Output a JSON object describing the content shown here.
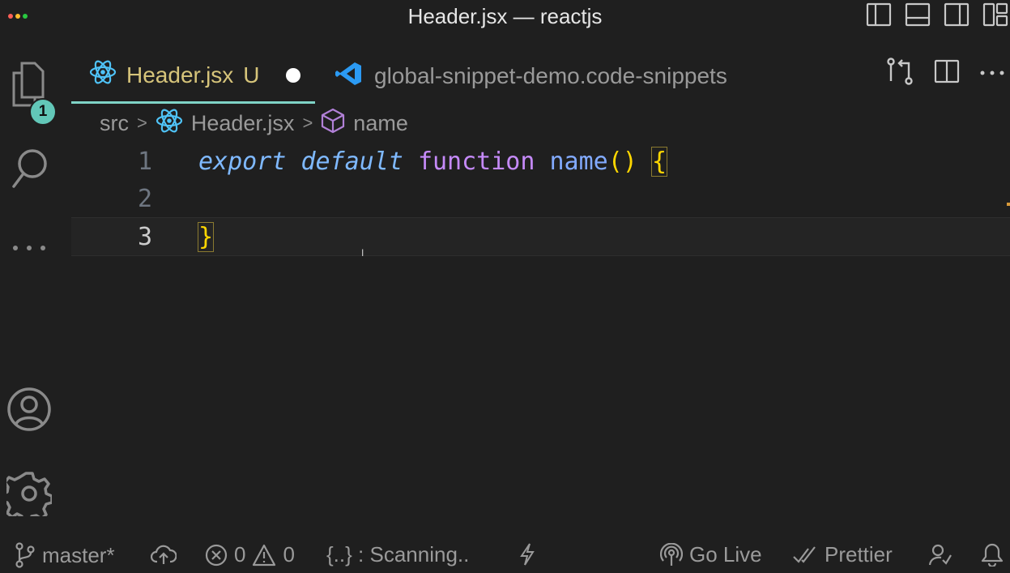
{
  "window": {
    "title": "Header.jsx — reactjs"
  },
  "activity_bar": {
    "explorer_badge": "1"
  },
  "tabs": [
    {
      "label": "Header.jsx",
      "status": "U",
      "modified": true,
      "icon": "react-icon",
      "active": true
    },
    {
      "label": "global-snippet-demo.code-snippets",
      "icon": "vscode-icon",
      "active": false
    }
  ],
  "breadcrumb": {
    "folder": "src",
    "file": "Header.jsx",
    "symbol": "name"
  },
  "editor": {
    "lines": [
      {
        "number": "1",
        "tokens": {
          "kw1": "export",
          "kw2": "default",
          "kw3": "function",
          "name": "name",
          "parens": "()",
          "open": "{"
        }
      },
      {
        "number": "2"
      },
      {
        "number": "3",
        "close": "}"
      }
    ]
  },
  "statusbar": {
    "branch": "master*",
    "errors": "0",
    "warnings": "0",
    "scanning": "{..} : Scanning..",
    "go_live": "Go Live",
    "prettier": "Prettier"
  },
  "colors": {
    "accent": "#7fd3c6",
    "badge": "#62c7b8",
    "modified_label": "#d6c47a"
  }
}
